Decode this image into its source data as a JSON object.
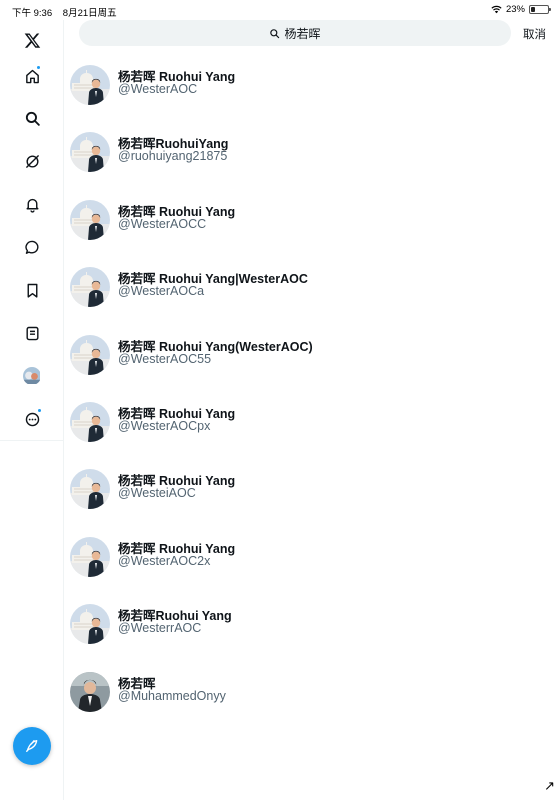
{
  "status_bar": {
    "time": "下午 9:36",
    "date": "8月21日周五",
    "battery": "23%",
    "battery_level": 0.23
  },
  "sidebar": {
    "items": [
      {
        "name": "x-logo-icon"
      },
      {
        "name": "home-icon",
        "badge": true
      },
      {
        "name": "search-icon"
      },
      {
        "name": "grok-icon"
      },
      {
        "name": "bell-icon"
      },
      {
        "name": "messages-icon"
      },
      {
        "name": "bookmark-icon"
      },
      {
        "name": "lists-icon"
      },
      {
        "name": "profile-avatar"
      },
      {
        "name": "more-icon",
        "badge": true
      }
    ],
    "compose_icon": "compose-feather-icon",
    "accent": "#1d9bf0"
  },
  "search": {
    "query": "杨若晖",
    "cancel_label": "取消"
  },
  "results": [
    {
      "name": "杨若晖 Ruohui Yang",
      "handle": "@WesterAOC",
      "avatar": "capitol"
    },
    {
      "name": "杨若晖RuohuiYang",
      "handle": "@ruohuiyang21875",
      "avatar": "capitol"
    },
    {
      "name": "杨若晖 Ruohui Yang",
      "handle": "@WesterAOCC",
      "avatar": "capitol"
    },
    {
      "name": "杨若晖 Ruohui Yang|WesterAOC",
      "handle": "@WesterAOCa",
      "avatar": "capitol"
    },
    {
      "name": "杨若晖 Ruohui Yang(WesterAOC)",
      "handle": "@WesterAOC55",
      "avatar": "capitol"
    },
    {
      "name": "杨若晖 Ruohui Yang",
      "handle": "@WesterAOCpx",
      "avatar": "capitol"
    },
    {
      "name": "杨若晖 Ruohui Yang",
      "handle": "@WesteiAOC",
      "avatar": "capitol"
    },
    {
      "name": "杨若晖 Ruohui Yang",
      "handle": "@WesterAOC2x",
      "avatar": "capitol"
    },
    {
      "name": "杨若晖Ruohui Yang",
      "handle": "@WesterrAOC",
      "avatar": "capitol"
    },
    {
      "name": "杨若晖",
      "handle": "@MuhammedOnyy",
      "avatar": "portrait"
    }
  ]
}
